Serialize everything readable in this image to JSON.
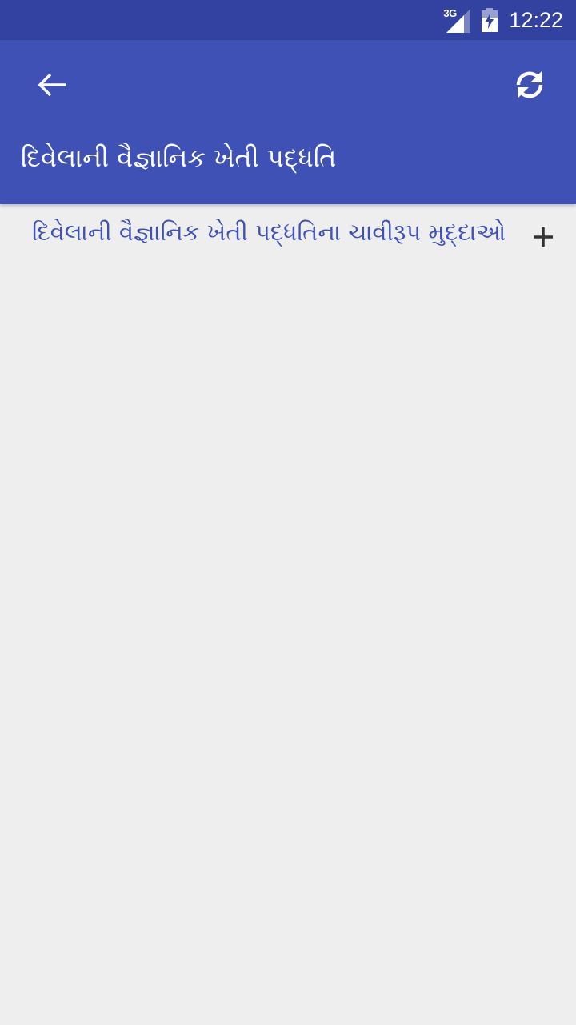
{
  "status_bar": {
    "network_type": "3G",
    "time": "12:22",
    "icons": [
      "signal-icon",
      "battery-charging-icon"
    ]
  },
  "toolbar": {
    "back_icon": "back-arrow-icon",
    "refresh_icon": "refresh-icon",
    "title": "દિવેલાની વૈજ્ઞાનિક ખેતી પદ્ધતિ"
  },
  "list": {
    "items": [
      {
        "label": "દિવેલાની વૈજ્ઞાનિક ખેતી પદ્ધતિના ચાવીરૂપ મુદ્દાઓ",
        "icon": "plus-icon"
      }
    ]
  },
  "colors": {
    "status_bar": "#3342A0",
    "app_bar": "#3F51B5",
    "accent_text": "#3F51B5",
    "background": "#EEEEEE",
    "icon_dark": "#333333"
  }
}
